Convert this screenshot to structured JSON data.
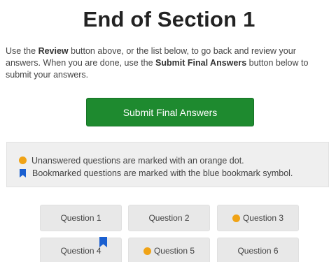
{
  "title": "End of Section 1",
  "instructions": {
    "line1_pre": "Use the ",
    "line1_bold": "Review",
    "line1_post": " button above, or the list below, to go back and review your answers.",
    "line2_pre": "When you are done, use the ",
    "line2_bold": "Submit Final Answers",
    "line2_post": " button below to submit your answers."
  },
  "submit_label": "Submit Final Answers",
  "legend": {
    "unanswered": "Unanswered questions are marked with an orange dot.",
    "bookmarked": "Bookmarked questions are marked with the blue bookmark symbol."
  },
  "colors": {
    "submit_green": "#1e8a2f",
    "unanswered_dot": "#f0a316",
    "bookmark_blue": "#1a5fd0"
  },
  "questions": [
    {
      "label": "Question 1",
      "unanswered": false,
      "bookmarked": false
    },
    {
      "label": "Question 2",
      "unanswered": false,
      "bookmarked": false
    },
    {
      "label": "Question 3",
      "unanswered": true,
      "bookmarked": false
    },
    {
      "label": "Question 4",
      "unanswered": false,
      "bookmarked": true
    },
    {
      "label": "Question 5",
      "unanswered": true,
      "bookmarked": false
    },
    {
      "label": "Question 6",
      "unanswered": false,
      "bookmarked": false
    }
  ]
}
